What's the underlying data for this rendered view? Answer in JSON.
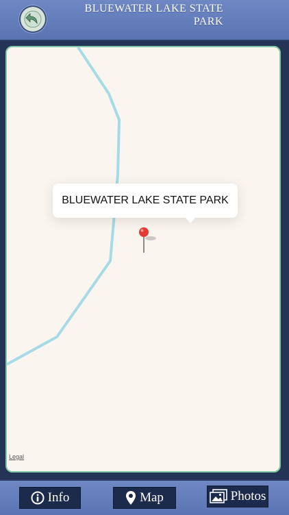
{
  "header": {
    "title": "BLUEWATER LAKE STATE PARK",
    "back_icon": "back-arrow-icon"
  },
  "map": {
    "callout_title": "BLUEWATER LAKE STATE PARK",
    "legal_link": "Legal",
    "pin_icon": "red-map-pin-icon",
    "colors": {
      "land": "#faf5ef",
      "water": "#a6dae6",
      "frame_border": "#7fc7a7"
    }
  },
  "toolbar": {
    "info_label": "Info",
    "map_label": "Map",
    "photos_label": "Photos",
    "icons": [
      "info-icon",
      "location-pin-icon",
      "photos-icon"
    ]
  },
  "theme": {
    "bar": "#6a83c0",
    "background": "#233457",
    "button": "#1c2a4c"
  }
}
